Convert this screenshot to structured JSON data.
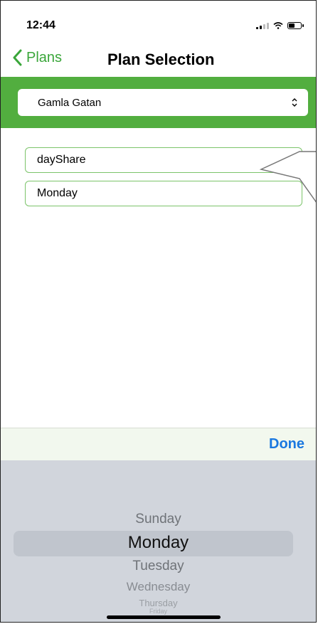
{
  "status": {
    "time": "12:44"
  },
  "nav": {
    "back_label": "Plans",
    "title": "Plan Selection"
  },
  "location_select": {
    "value": "Gamla Gatan"
  },
  "fields": {
    "plan": "dayShare",
    "day": "Monday"
  },
  "toolbar": {
    "done_label": "Done"
  },
  "picker": {
    "options": [
      "Sunday",
      "Monday",
      "Tuesday",
      "Wednesday",
      "Thursday",
      "Friday"
    ],
    "selected": "Monday"
  },
  "colors": {
    "accent_green": "#52ae3f",
    "done_blue": "#1a78e0",
    "picker_bg": "#d1d5dc"
  },
  "icons": {
    "back": "chevron-left-icon",
    "select": "chevron-up-down-icon"
  }
}
